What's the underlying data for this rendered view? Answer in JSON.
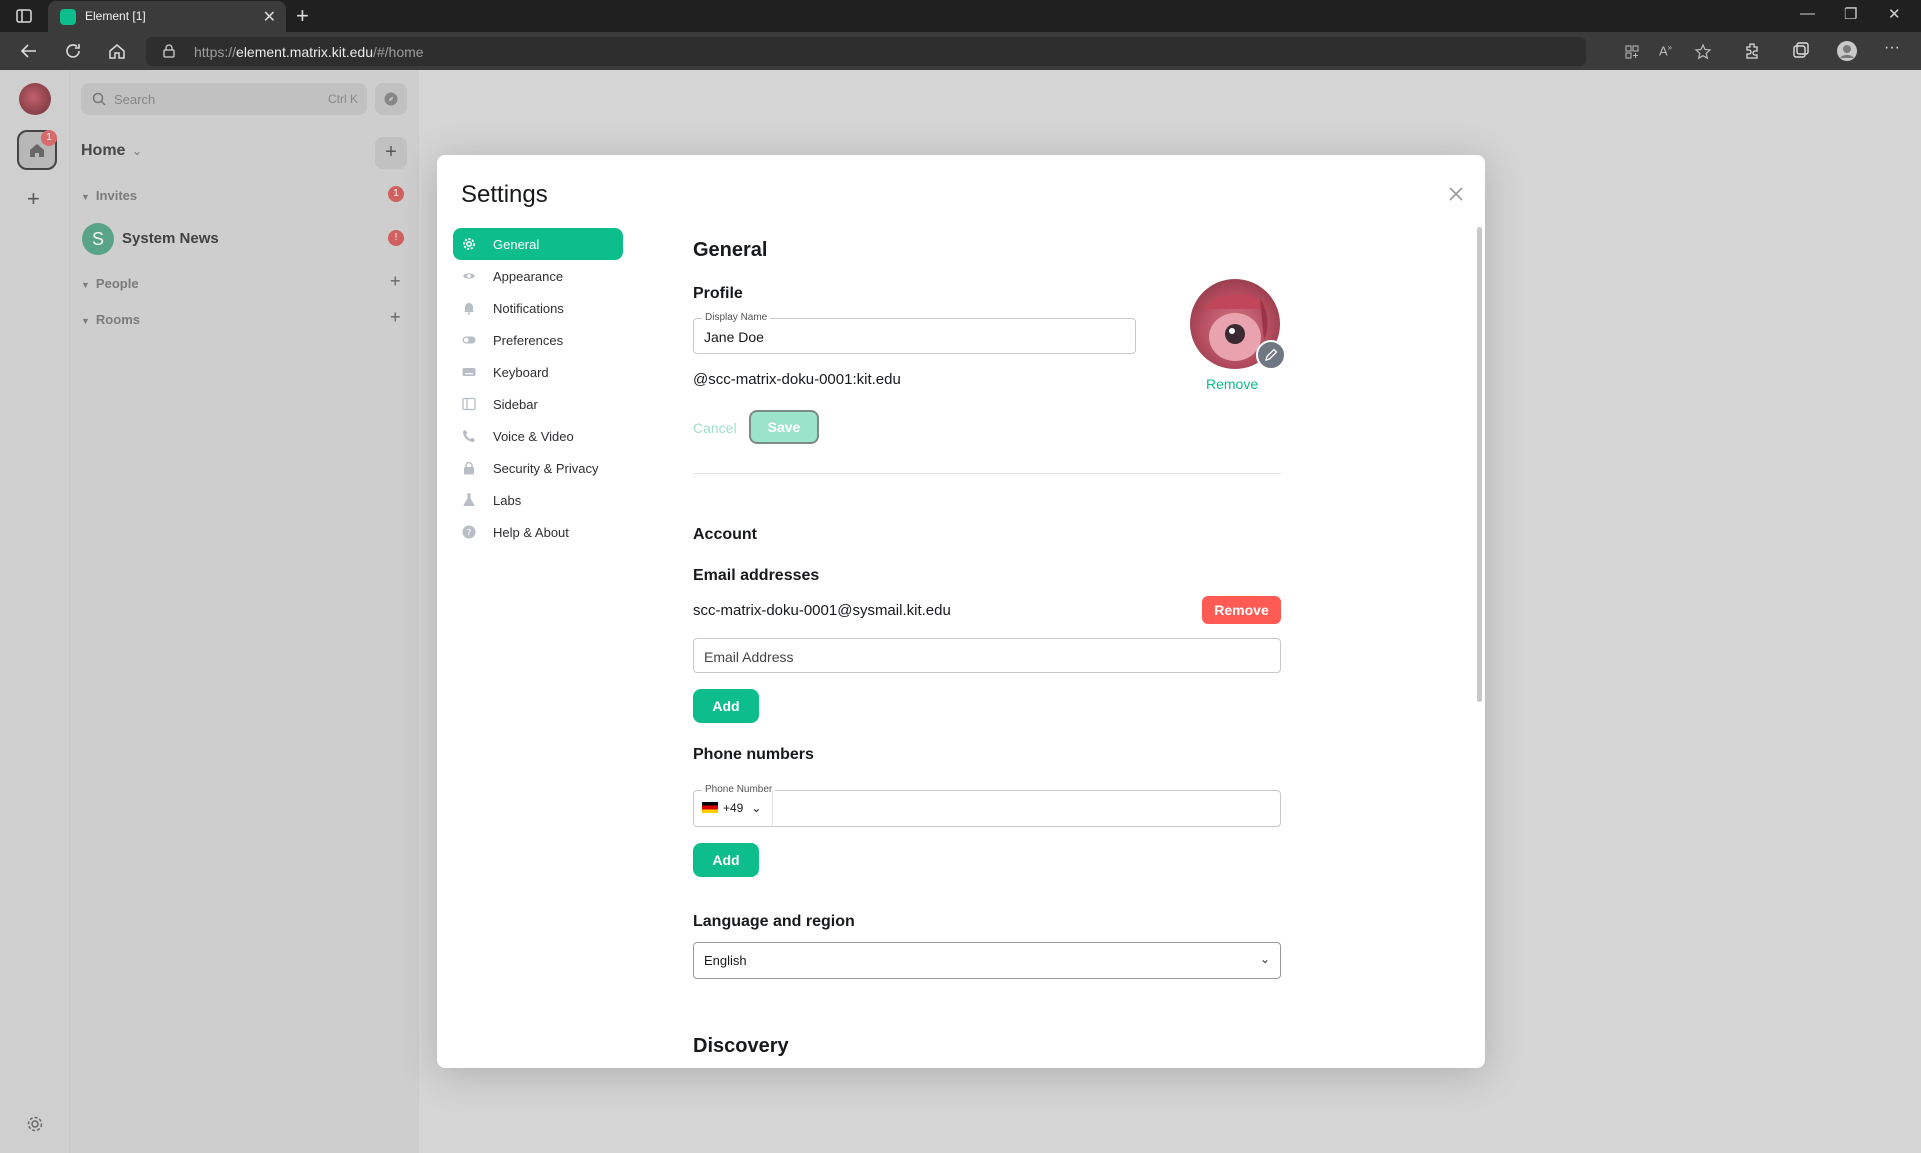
{
  "browser": {
    "tab_title": "Element [1]",
    "url_prefix": "https://",
    "url_host": "element.matrix.kit.edu",
    "url_path": "/#/home"
  },
  "app": {
    "home_badge": "1",
    "search_placeholder": "Search",
    "search_shortcut": "Ctrl K",
    "home_title": "Home",
    "sections": {
      "invites": "Invites",
      "invites_badge": "1",
      "people": "People",
      "rooms": "Rooms"
    },
    "room": {
      "avatar_letter": "S",
      "name": "System News",
      "badge": "!"
    }
  },
  "settings": {
    "title": "Settings",
    "nav": [
      {
        "label": "General",
        "icon": "gear-icon"
      },
      {
        "label": "Appearance",
        "icon": "eye-icon"
      },
      {
        "label": "Notifications",
        "icon": "bell-icon"
      },
      {
        "label": "Preferences",
        "icon": "toggle-icon"
      },
      {
        "label": "Keyboard",
        "icon": "keyboard-icon"
      },
      {
        "label": "Sidebar",
        "icon": "sidebar-icon"
      },
      {
        "label": "Voice & Video",
        "icon": "phone-icon"
      },
      {
        "label": "Security & Privacy",
        "icon": "lock-icon"
      },
      {
        "label": "Labs",
        "icon": "flask-icon"
      },
      {
        "label": "Help & About",
        "icon": "help-icon"
      }
    ],
    "general": {
      "heading": "General",
      "profile_heading": "Profile",
      "display_name_label": "Display Name",
      "display_name_value": "Jane Doe",
      "matrix_id": "@scc-matrix-doku-0001:kit.edu",
      "cancel_label": "Cancel",
      "save_label": "Save",
      "avatar_remove_label": "Remove",
      "account_heading": "Account",
      "email_heading": "Email addresses",
      "email_value": "scc-matrix-doku-0001@sysmail.kit.edu",
      "email_remove_label": "Remove",
      "email_placeholder": "Email Address",
      "add_label": "Add",
      "phone_heading": "Phone numbers",
      "phone_label": "Phone Number",
      "phone_country_code": "+49",
      "language_heading": "Language and region",
      "language_value": "English",
      "discovery_heading": "Discovery"
    }
  },
  "colors": {
    "accent": "#0dbd8b",
    "danger": "#ff5b55"
  }
}
